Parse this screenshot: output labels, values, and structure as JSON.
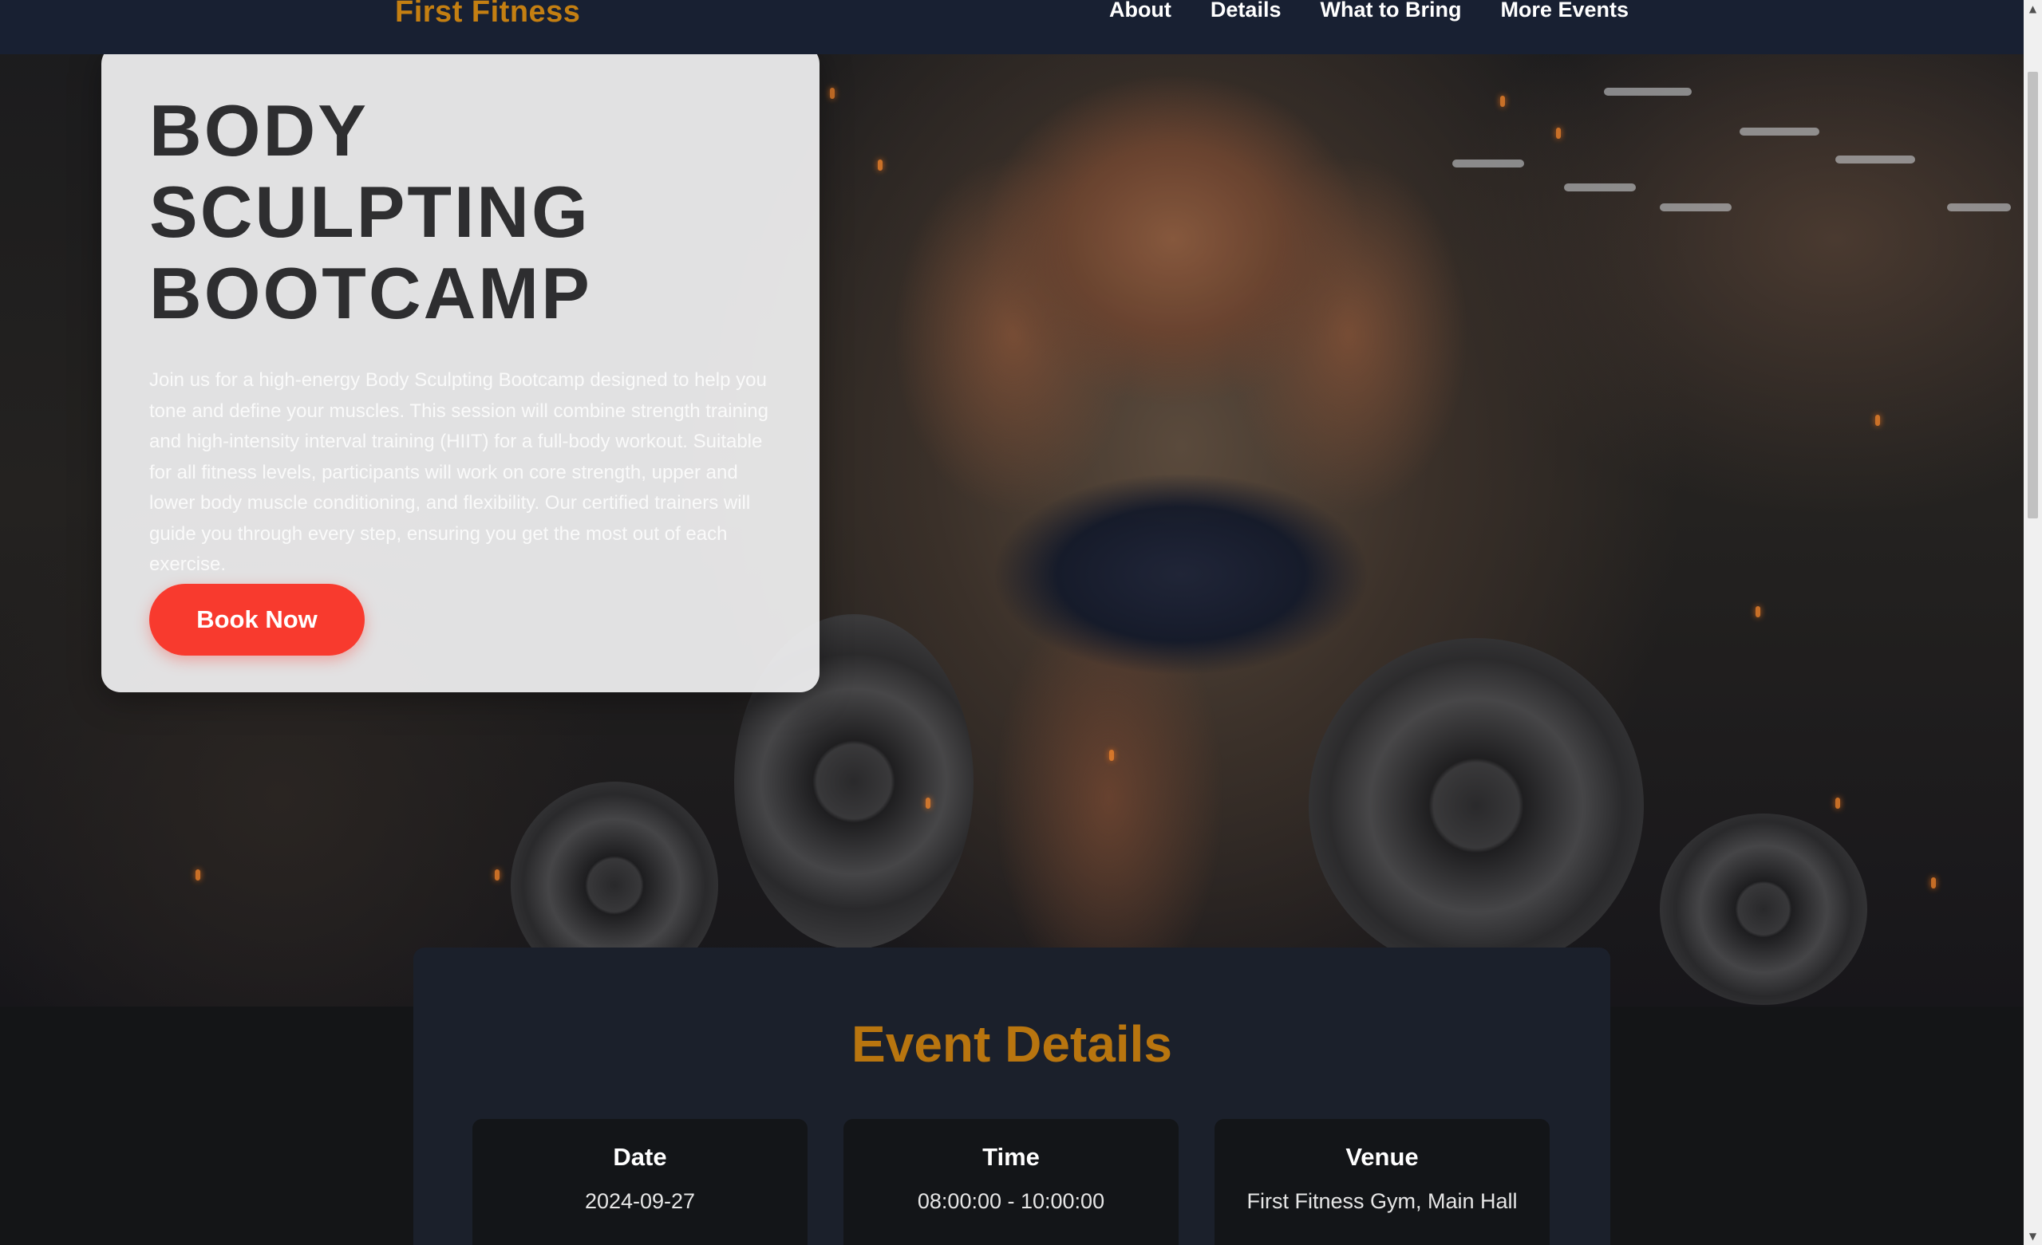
{
  "brand": {
    "name": "First Fitness",
    "color": "#c47f12"
  },
  "nav": {
    "links": [
      {
        "label": "About"
      },
      {
        "label": "Details"
      },
      {
        "label": "What to Bring"
      },
      {
        "label": "More Events"
      }
    ]
  },
  "hero": {
    "title": "BODY SCULPTING BOOTCAMP",
    "description": "Join us for a high-energy Body Sculpting Bootcamp designed to help you tone and define your muscles. This session will combine strength training and high-intensity interval training (HIIT) for a full-body workout. Suitable for all fitness levels, participants will work on core strength, upper and lower body muscle conditioning, and flexibility. Our certified trainers will guide you through every step, ensuring you get the most out of each exercise.",
    "cta_label": "Book Now",
    "cta_color": "#f83a2e"
  },
  "event_details": {
    "title": "Event Details",
    "items": [
      {
        "label": "Date",
        "value": "2024-09-27"
      },
      {
        "label": "Time",
        "value": "08:00:00 - 10:00:00"
      },
      {
        "label": "Venue",
        "value": "First Fitness Gym, Main Hall"
      }
    ]
  },
  "icons": {
    "scroll_up": "triangle-up",
    "scroll_down": "triangle-down"
  }
}
